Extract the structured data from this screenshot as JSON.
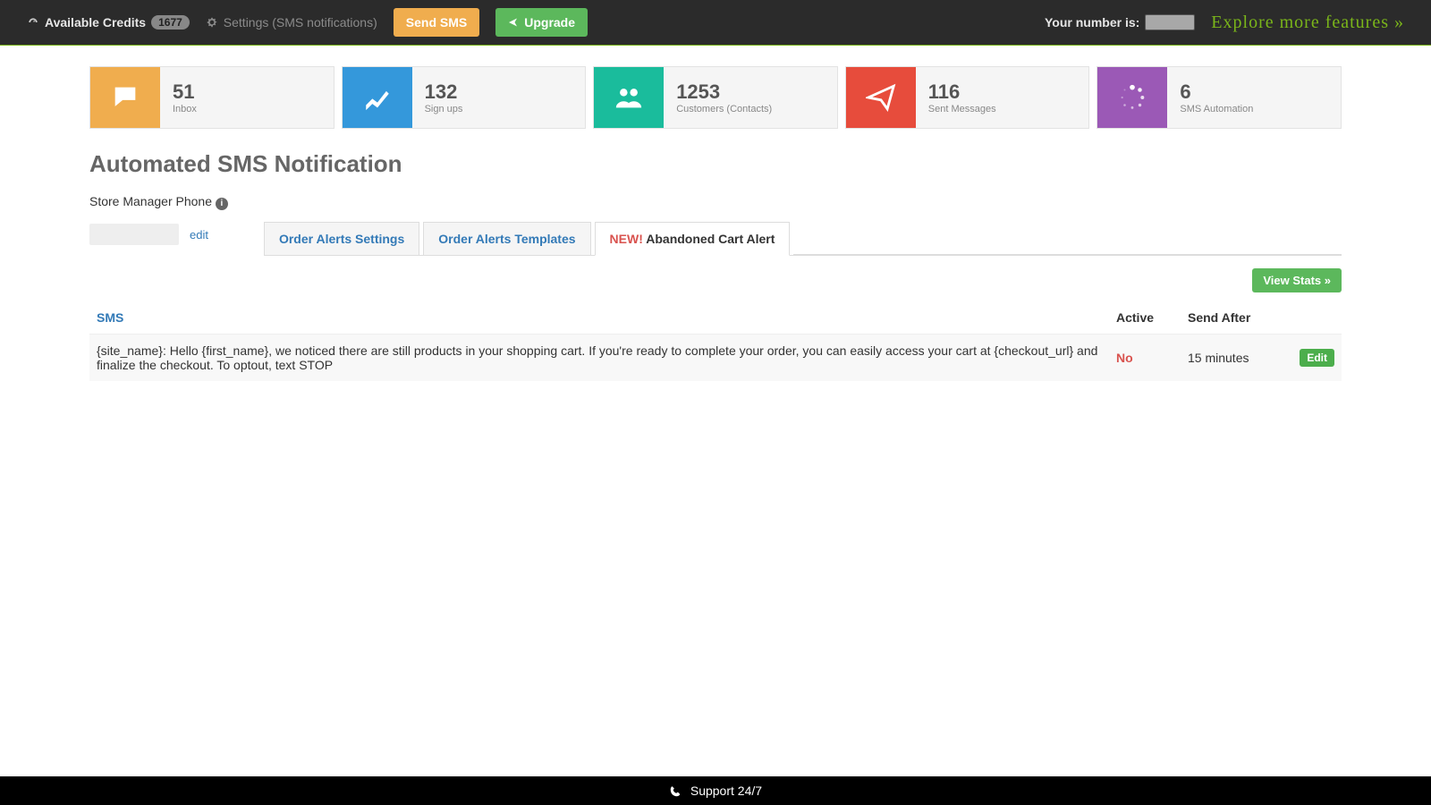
{
  "topbar": {
    "credits_label": "Available Credits",
    "credits_value": "1677",
    "settings_label": "Settings (SMS notifications)",
    "send_sms_label": "Send SMS",
    "upgrade_label": "Upgrade",
    "your_number_label": "Your number is:",
    "explore_label": "Explore more features »"
  },
  "stats": [
    {
      "value": "51",
      "label": "Inbox",
      "color": "bg-orange",
      "icon": "chat"
    },
    {
      "value": "132",
      "label": "Sign ups",
      "color": "bg-blue",
      "icon": "chart"
    },
    {
      "value": "1253",
      "label": "Customers (Contacts)",
      "color": "bg-teal",
      "icon": "users"
    },
    {
      "value": "116",
      "label": "Sent Messages",
      "color": "bg-red",
      "icon": "send"
    },
    {
      "value": "6",
      "label": "SMS Automation",
      "color": "bg-purple",
      "icon": "spinner"
    }
  ],
  "page_title": "Automated SMS Notification",
  "phone_section": {
    "label": "Store Manager Phone",
    "edit": "edit"
  },
  "tabs": {
    "t1": "Order Alerts Settings",
    "t2": "Order Alerts Templates",
    "t3_new": "NEW!",
    "t3": "Abandoned Cart Alert"
  },
  "view_stats": "View Stats »",
  "table": {
    "cols": {
      "sms": "SMS",
      "active": "Active",
      "send_after": "Send After"
    },
    "rows": [
      {
        "sms": "{site_name}: Hello {first_name}, we noticed there are still products in your shopping cart. If you're ready to complete your order, you can easily access your cart at {checkout_url} and finalize the checkout. To optout, text STOP",
        "active": "No",
        "send_after": "15 minutes",
        "edit": "Edit"
      }
    ]
  },
  "footer": {
    "support": "Support 24/7"
  }
}
